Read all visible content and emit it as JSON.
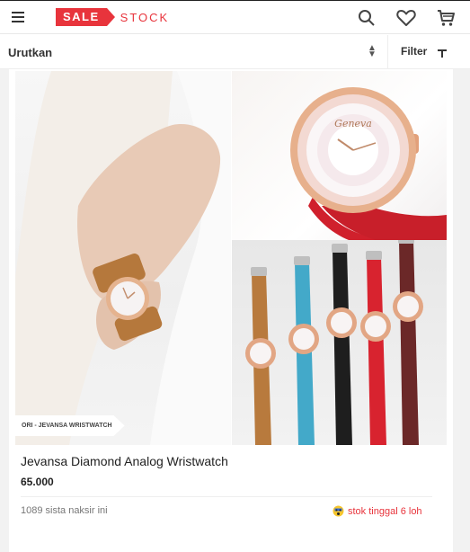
{
  "header": {
    "logo_sale": "SALE",
    "logo_stock": "STOCK",
    "icons": [
      "menu-icon",
      "search-icon",
      "heart-icon",
      "cart-icon"
    ]
  },
  "sortbar": {
    "sort_label": "Urutkan",
    "filter_label": "Filter"
  },
  "product": {
    "badge": "ORI - JEVANSA WRISTWATCH",
    "watch_dial_brand": "Geneva",
    "title": "Jevansa Diamond Analog Wristwatch",
    "price": "65.000",
    "likes": "1089 sista naksir ini",
    "stock": "stok tinggal 6 loh",
    "strap_colors": [
      "#b87a3d",
      "#43a9c9",
      "#1e1e1e",
      "#d8232f",
      "#6b2828"
    ]
  },
  "colors": {
    "brand": "#e8343c",
    "stock_text": "#e8343c"
  }
}
